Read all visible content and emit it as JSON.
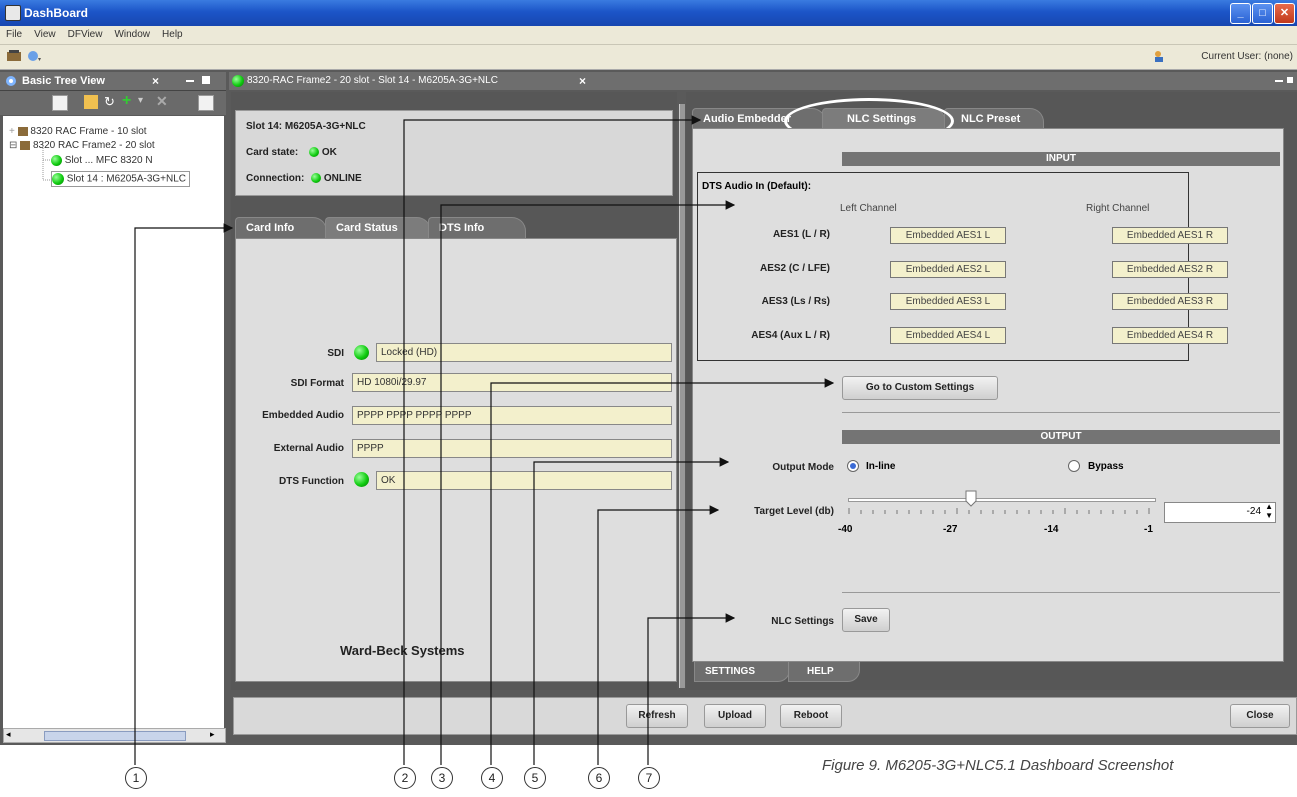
{
  "window": {
    "title": "DashBoard",
    "min": "_",
    "max": "□",
    "close": "✕"
  },
  "menu": [
    "File",
    "View",
    "DFView",
    "Window",
    "Help"
  ],
  "toolbar": {
    "current_user": "Current User: (none)"
  },
  "tree": {
    "title": "Basic Tree View",
    "close": "×",
    "items": [
      "8320 RAC Frame - 10 slot",
      "8320 RAC Frame2 - 20 slot",
      "Slot ... MFC 8320 N",
      "Slot 14 : M6205A-3G+NLC"
    ]
  },
  "editor": {
    "tab_title": "8320-RAC Frame2 - 20 slot - Slot 14 - M6205A-3G+NLC",
    "close": "×",
    "slot_info": {
      "slot": "Slot 14: M6205A-3G+NLC",
      "card_state_label": "Card state:",
      "card_state_value": "OK",
      "connection_label": "Connection:",
      "connection_value": "ONLINE"
    },
    "card_tabs": [
      "Card Info",
      "Card Status",
      "DTS Info"
    ],
    "status_fields": [
      {
        "label": "SDI",
        "value": "Locked (HD)"
      },
      {
        "label": "SDI Format",
        "value": "HD 1080i/29.97"
      },
      {
        "label": "Embedded Audio",
        "value": "PPPP PPPP PPPP PPPP"
      },
      {
        "label": "External Audio",
        "value": "PPPP"
      },
      {
        "label": "DTS Function",
        "value": "OK"
      }
    ],
    "brand": "Ward-Beck Systems",
    "right_tabs": [
      "Audio Embedder",
      "NLC Settings",
      "NLC Preset"
    ],
    "input": {
      "header": "INPUT",
      "dts_label": "DTS Audio In (Default):",
      "left_channel": "Left Channel",
      "right_channel": "Right Channel",
      "rows": [
        {
          "label": "AES1 (L / R)",
          "left": "Embedded AES1 L",
          "right": "Embedded AES1 R"
        },
        {
          "label": "AES2 (C / LFE)",
          "left": "Embedded AES2 L",
          "right": "Embedded AES2 R"
        },
        {
          "label": "AES3 (Ls / Rs)",
          "left": "Embedded AES3 L",
          "right": "Embedded AES3 R"
        },
        {
          "label": "AES4 (Aux L / R)",
          "left": "Embedded AES4 L",
          "right": "Embedded AES4 R"
        }
      ],
      "custom_button": "Go to Custom Settings"
    },
    "output": {
      "header": "OUTPUT",
      "mode_label": "Output Mode",
      "mode_inline": "In-line",
      "mode_bypass": "Bypass",
      "target_label": "Target Level (db)",
      "target_value": "-24",
      "ticks": [
        "-40",
        "-27",
        "-14",
        "-1"
      ]
    },
    "nlc_label": "NLC Settings",
    "save_button": "Save",
    "bottom_tabs": [
      "SETTINGS",
      "HELP"
    ],
    "buttons": {
      "refresh": "Refresh",
      "upload": "Upload",
      "reboot": "Reboot",
      "close": "Close"
    }
  },
  "callouts": [
    "1",
    "2",
    "3",
    "4",
    "5",
    "6",
    "7"
  ],
  "caption": "Figure 9. M6205-3G+NLC5.1 Dashboard Screenshot"
}
